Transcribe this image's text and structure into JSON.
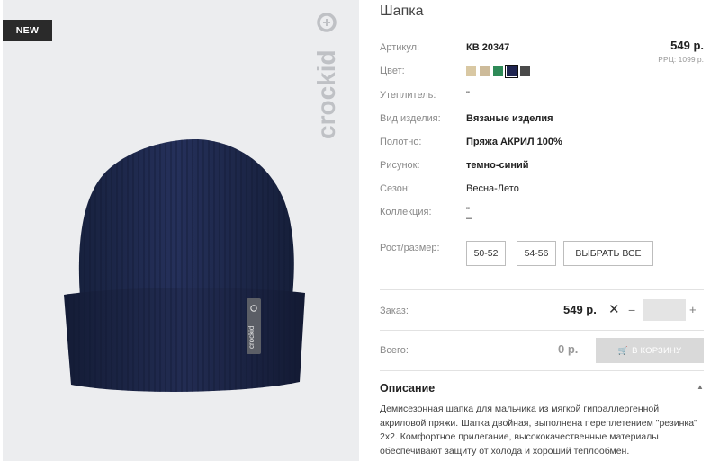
{
  "product": {
    "badge": "NEW",
    "brand": "crockid",
    "title": "Шапка"
  },
  "pricing": {
    "price": "549 р.",
    "rrp": "РРЦ: 1099 р."
  },
  "specs": [
    {
      "label": "Артикул:",
      "value": "КВ 20347",
      "bold": true
    },
    {
      "label": "Цвет:",
      "value": ""
    },
    {
      "label": "Утеплитель:",
      "value": "\""
    },
    {
      "label": "Вид изделия:",
      "value": "Вязаные изделия",
      "bold": true
    },
    {
      "label": "Полотно:",
      "value": "Пряжа АКРИЛ 100%",
      "bold": true
    },
    {
      "label": "Рисунок:",
      "value": "темно-синий",
      "bold": true
    },
    {
      "label": "Сезон:",
      "value": "Весна-Лето"
    },
    {
      "label": "Коллекция:",
      "value": "\"",
      "value2": "–"
    }
  ],
  "colors": [
    {
      "name": "beige-light",
      "hex": "#d9c8a3"
    },
    {
      "name": "beige",
      "hex": "#cdbb9a"
    },
    {
      "name": "green",
      "hex": "#2e8a57"
    },
    {
      "name": "navy",
      "hex": "#1f2450",
      "selected": true
    },
    {
      "name": "dark-gray",
      "hex": "#4a4a4a"
    }
  ],
  "sizes": {
    "label": "Рост/размер:",
    "options": [
      "50-52",
      "54-56"
    ],
    "select_all": "ВЫБРАТЬ ВСЕ"
  },
  "order": {
    "label": "Заказ:",
    "price": "549 р.",
    "times": "✕",
    "minus": "−",
    "plus": "+",
    "quantity": ""
  },
  "total": {
    "label": "Всего:",
    "value": "0 р.",
    "cart_button": "В КОРЗИНУ"
  },
  "description": {
    "heading": "Описание",
    "caret": "▲",
    "text": "Демисезонная шапка для мальчика из мягкой гипоаллергенной акриловой пряжи. Шапка двойная, выполнена переплетением \"резинка\" 2х2. Комфортное прилегание, высококачественные материалы обеспечивают защиту от холода и хороший теплообмен."
  }
}
